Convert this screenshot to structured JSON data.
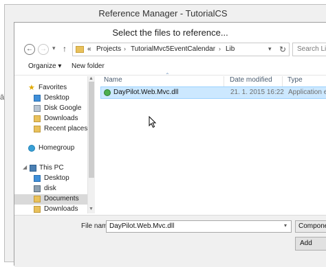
{
  "window": {
    "outer_title": "Reference Manager - TutorialCS",
    "edge_glyph": "ā"
  },
  "dialog": {
    "title": "Select the files to reference..."
  },
  "nav": {
    "back": "←",
    "forward": "→",
    "up": "↑"
  },
  "breadcrumb": {
    "overflow": "«",
    "parts": [
      "Projects",
      "TutorialMvc5EventCalendar",
      "Lib"
    ],
    "separator": "›"
  },
  "search": {
    "placeholder": "Search Lib"
  },
  "toolbar": {
    "organize_label": "Organize ▾",
    "new_folder_label": "New folder"
  },
  "sidebar": {
    "favorites": {
      "label": "Favorites",
      "items": [
        "Desktop",
        "Disk Google",
        "Downloads",
        "Recent places"
      ]
    },
    "homegroup": "Homegroup",
    "this_pc": {
      "label": "This PC",
      "items": [
        "Desktop",
        "disk",
        "Documents",
        "Downloads"
      ]
    }
  },
  "columns": {
    "name": "Name",
    "date_modified": "Date modified",
    "type": "Type"
  },
  "files": [
    {
      "name": "DayPilot.Web.Mvc.dll",
      "date": "21. 1. 2015 16:22",
      "type": "Application ext",
      "icon": "dll-icon",
      "selected": true
    }
  ],
  "filename": {
    "label": "File name:",
    "value": "DayPilot.Web.Mvc.dll"
  },
  "filter": {
    "label": "Component Files"
  },
  "buttons": {
    "add": "Add"
  },
  "colors": {
    "selection": "#cce8ff",
    "selection_border": "#99d1ff",
    "column_header": "#4a5c70"
  }
}
